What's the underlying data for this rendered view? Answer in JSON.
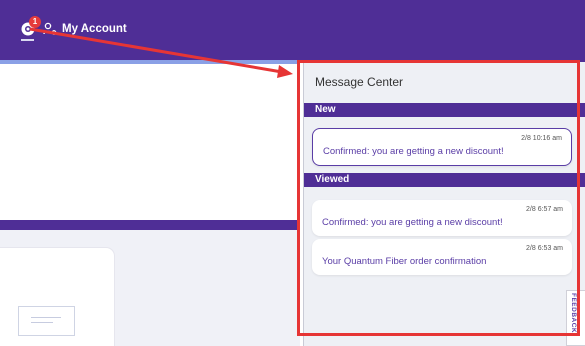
{
  "header": {
    "notification_count": "1",
    "account_label": "My Account"
  },
  "message_center": {
    "title": "Message Center",
    "sections": [
      {
        "label": "New",
        "messages": [
          {
            "time": "2/8 10:16 am",
            "text": "Confirmed: you are getting a new discount!"
          }
        ]
      },
      {
        "label": "Viewed",
        "messages": [
          {
            "time": "2/8 6:57 am",
            "text": "Confirmed: you are getting a new discount!"
          },
          {
            "time": "2/8 6:53 am",
            "text": "Your Quantum Fiber order confirmation"
          }
        ]
      }
    ]
  },
  "feedback_tab": {
    "label": "FEEDBACK"
  },
  "colors": {
    "brand_purple": "#4f2e96",
    "annotation_red": "#e63535",
    "message_text": "#5a3da6",
    "badge_red": "#e53b3b"
  }
}
